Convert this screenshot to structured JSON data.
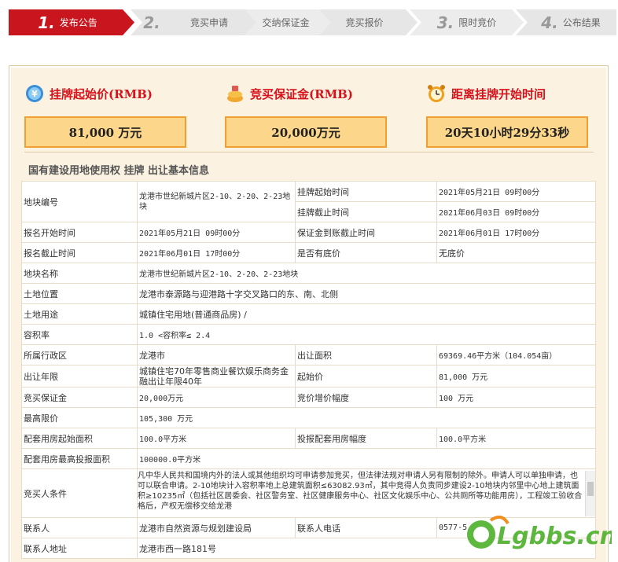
{
  "steps": [
    {
      "num": "1.",
      "label": "发布公告",
      "active": true
    },
    {
      "num": "2.",
      "label": "",
      "active": false
    },
    {
      "num": "",
      "label": "竞买申请",
      "active": false
    },
    {
      "num": "",
      "label": "交纳保证金",
      "active": false
    },
    {
      "num": "",
      "label": "竞买报价",
      "active": false
    },
    {
      "num": "3.",
      "label": "限时竞价",
      "active": false
    },
    {
      "num": "4.",
      "label": "公布结果",
      "active": false
    }
  ],
  "cards": {
    "start_price": {
      "label": "挂牌起始价(RMB)",
      "value": "81,000 万元"
    },
    "deposit": {
      "label": "竞买保证金(RMB)",
      "value": "20,000万元"
    },
    "countdown": {
      "label": "距离挂牌开始时间",
      "value": "20天10小时29分33秒"
    }
  },
  "section_title": "国有建设用地使用权 挂牌 出让基本信息",
  "table": {
    "parcel_no_k": "地块编号",
    "parcel_no_v": "龙港市世纪新城片区2-10、2-20、2-23地块",
    "listing_start_k": "挂牌起始时间",
    "listing_start_v": "2021年05月21日 09时00分",
    "listing_end_k": "挂牌截止时间",
    "listing_end_v": "2021年06月03日 09时00分",
    "reg_start_k": "报名开始时间",
    "reg_start_v": "2021年05月21日 09时00分",
    "deposit_deadline_k": "保证金到账截止时间",
    "deposit_deadline_v": "2021年06月01日 17时00分",
    "reg_end_k": "报名截止时间",
    "reg_end_v": "2021年06月01日 17时00分",
    "reserve_k": "是否有底价",
    "reserve_v": "无底价",
    "name_k": "地块名称",
    "name_v": "龙港市世纪新城片区2-10、2-20、2-23地块",
    "location_k": "土地位置",
    "location_v": "龙港市泰源路与迎港路十字交叉路口的东、南、北侧",
    "usage_k": "土地用途",
    "usage_v": "城镇住宅用地(普通商品房) /",
    "far_k": "容积率",
    "far_v": "1.0 <容积率≤ 2.4",
    "district_k": "所属行政区",
    "district_v": "龙港市",
    "area_k": "出让面积",
    "area_v": "69369.46平方米（104.054亩）",
    "term_k": "出让年限",
    "term_v": "城镇住宅70年零售商业餐饮娱乐商务金融出让年限40年",
    "start_price_k": "起始价",
    "start_price_v": "81,000 万元",
    "bid_deposit_k": "竞买保证金",
    "bid_deposit_v": "20,000万元",
    "increment_k": "竞价增价幅度",
    "increment_v": "100 万元",
    "max_price_k": "最高限价",
    "max_price_v": "105,300 万元",
    "housing_start_k": "配套用房起始面积",
    "housing_start_v": "100.0平方米",
    "housing_incr_k": "投报配套用房幅度",
    "housing_incr_v": "100.0平方米",
    "housing_max_k": "配套用房最高投报面积",
    "housing_max_v": "100000.0平方米",
    "cond_k": "竞买人条件",
    "cond_v": "凡中华人民共和国境内外的法人或其他组织均可申请参加竞买，但法律法规对申请人另有限制的除外。申请人可以单独申请，也可以联合申请。2-10地块计入容积率地上总建筑面积≤63082.93㎡，其中竞得人负责同步建设2-10地块内邻里中心地上建筑面积≥10235㎡（包括社区居委会、社区警务室、社区健康服务中心、社区文化娱乐中心、公共厕所等功能用房），工程竣工验收合格后，产权无偿移交给龙港",
    "contact_k": "联系人",
    "contact_v": "龙港市自然资源与规划建设局",
    "phone_k": "联系人电话",
    "phone_v": "0577-5",
    "address_k": "联系人地址",
    "address_v": "龙港市西一路181号"
  },
  "watermark": "Lgbbs.cn"
}
